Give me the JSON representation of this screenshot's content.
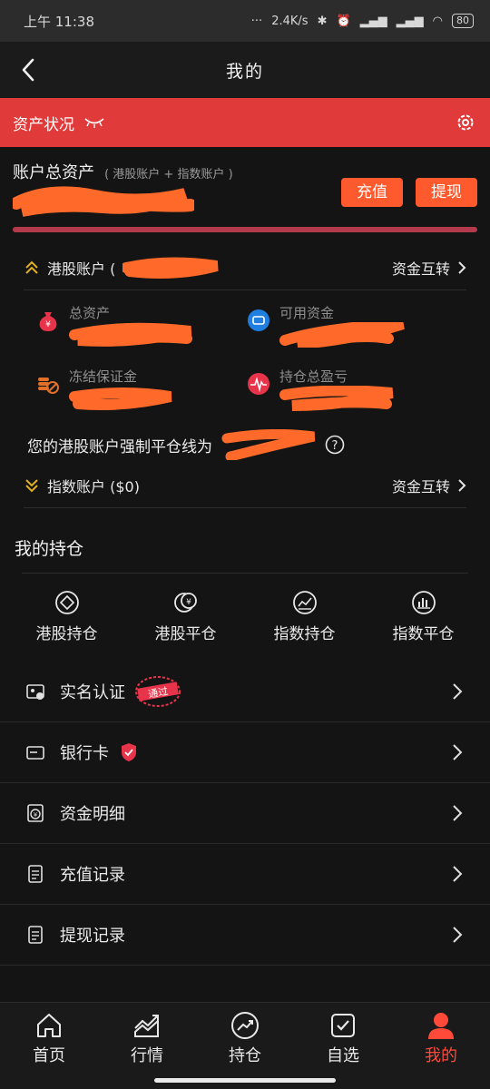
{
  "status": {
    "time": "上午 11:38",
    "net_speed": "2.4K/s",
    "battery": "80"
  },
  "nav": {
    "title": "我的"
  },
  "asset_bar": {
    "label": "资产状况"
  },
  "total": {
    "title": "账户总资产",
    "subtitle": "( 港股账户 + 指数账户 )",
    "recharge_label": "充值",
    "withdraw_label": "提现"
  },
  "hk_account": {
    "label": "港股账户 (",
    "transfer_label": "资金互转"
  },
  "stats": {
    "total_assets_label": "总资产",
    "available_funds_label": "可用资金",
    "frozen_margin_label": "冻结保证金",
    "holding_pl_label": "持仓总盈亏"
  },
  "liquidation": {
    "text": "您的港股账户强制平仓线为"
  },
  "index_account": {
    "label": "指数账户 ($0)",
    "transfer_label": "资金互转"
  },
  "my_positions": {
    "title": "我的持仓",
    "items": [
      {
        "label": "港股持仓",
        "icon": "hk-holding-icon"
      },
      {
        "label": "港股平仓",
        "icon": "hk-close-icon"
      },
      {
        "label": "指数持仓",
        "icon": "index-holding-icon"
      },
      {
        "label": "指数平仓",
        "icon": "index-close-icon"
      }
    ]
  },
  "menu": {
    "verify_label": "实名认证",
    "verify_stamp": "通过",
    "bank_label": "银行卡",
    "funds_label": "资金明细",
    "recharge_records_label": "充值记录",
    "withdraw_records_label": "提现记录"
  },
  "tabs": [
    {
      "label": "首页"
    },
    {
      "label": "行情"
    },
    {
      "label": "持仓"
    },
    {
      "label": "自选"
    },
    {
      "label": "我的"
    }
  ],
  "colors": {
    "accent_red": "#e03a3a",
    "button_orange": "#ff5a2e",
    "scribble_orange": "#ff6a2a",
    "active_tab": "#ff4a3a"
  }
}
